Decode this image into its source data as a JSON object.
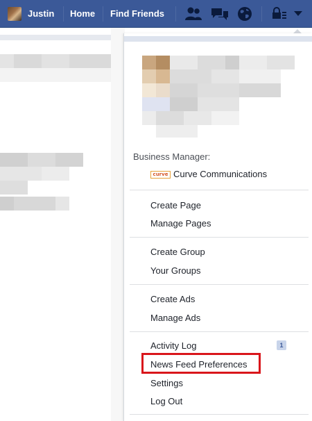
{
  "topbar": {
    "user_name": "Justin",
    "home_label": "Home",
    "find_friends_label": "Find Friends"
  },
  "menu": {
    "business_manager_label": "Business Manager:",
    "business_logo_text": "curve",
    "business_name": "Curve Communications",
    "create_page": "Create Page",
    "manage_pages": "Manage Pages",
    "create_group": "Create Group",
    "your_groups": "Your Groups",
    "create_ads": "Create Ads",
    "manage_ads": "Manage Ads",
    "activity_log": "Activity Log",
    "activity_log_badge": "1",
    "news_feed_preferences": "News Feed Preferences",
    "settings": "Settings",
    "log_out": "Log Out"
  },
  "colors": {
    "topbar": "#3b5998",
    "highlight": "#d9161b",
    "text": "#1d2129"
  },
  "icons": [
    "friend-requests-icon",
    "messages-icon",
    "notifications-globe-icon",
    "privacy-lock-icon",
    "account-menu-caret-icon"
  ]
}
